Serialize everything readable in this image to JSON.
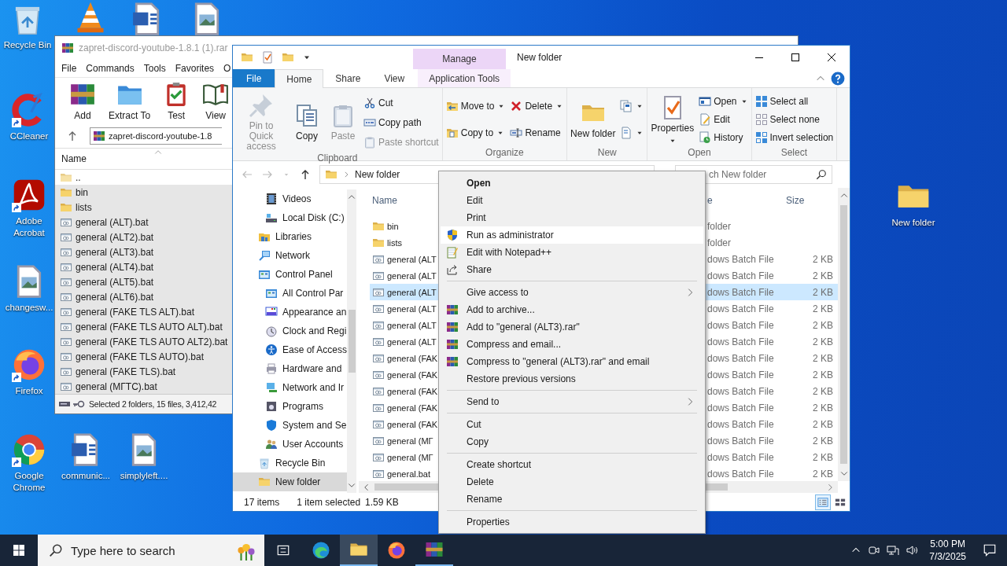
{
  "desktop_icons": [
    {
      "kind": "recycle",
      "label": "Recycle Bin",
      "shortcut": false
    },
    {
      "kind": "cone",
      "shortcut": false
    },
    {
      "kind": "word",
      "shortcut": false
    },
    {
      "kind": "image",
      "shortcut": false
    },
    {
      "kind": "ccleaner",
      "label": "CCleaner",
      "shortcut": true
    },
    {
      "kind": "acrobat",
      "label": "Adobe Acrobat",
      "shortcut": true
    },
    {
      "kind": "image",
      "label": "changesw...",
      "shortcut": false
    },
    {
      "kind": "firefox",
      "label": "Firefox",
      "shortcut": true
    },
    {
      "kind": "chrome",
      "label": "Google Chrome",
      "shortcut": true
    },
    {
      "kind": "word",
      "label": "communic...",
      "shortcut": false
    },
    {
      "kind": "image",
      "label": "simplyleft....",
      "shortcut": false
    },
    {
      "kind": "folder",
      "label": "New folder",
      "shortcut": false
    }
  ],
  "archive_window": {
    "title": "zapret-discord-youtube-1.8.1 (1).rar",
    "menu": [
      "File",
      "Commands",
      "Tools",
      "Favorites",
      "O"
    ],
    "toolbar": [
      {
        "kind": "add",
        "label": "Add"
      },
      {
        "kind": "extract",
        "label": "Extract To"
      },
      {
        "kind": "test",
        "label": "Test"
      },
      {
        "kind": "view",
        "label": "View"
      }
    ],
    "path": "zapret-discord-youtube-1.8",
    "column": "Name",
    "rows": [
      {
        "kind": "updir",
        "name": "..",
        "selected": false
      },
      {
        "kind": "folder",
        "name": "bin",
        "selected": true
      },
      {
        "kind": "folder",
        "name": "lists",
        "selected": true
      },
      {
        "kind": "bat",
        "name": "general (ALT).bat",
        "selected": true
      },
      {
        "kind": "bat",
        "name": "general (ALT2).bat",
        "selected": true
      },
      {
        "kind": "bat",
        "name": "general (ALT3).bat",
        "selected": true
      },
      {
        "kind": "bat",
        "name": "general (ALT4).bat",
        "selected": true
      },
      {
        "kind": "bat",
        "name": "general (ALT5).bat",
        "selected": true
      },
      {
        "kind": "bat",
        "name": "general (ALT6).bat",
        "selected": true
      },
      {
        "kind": "bat",
        "name": "general (FAKE TLS ALT).bat",
        "selected": true
      },
      {
        "kind": "bat",
        "name": "general (FAKE TLS AUTO ALT).bat",
        "selected": true
      },
      {
        "kind": "bat",
        "name": "general (FAKE TLS AUTO ALT2).bat",
        "selected": true
      },
      {
        "kind": "bat",
        "name": "general (FAKE TLS AUTO).bat",
        "selected": true
      },
      {
        "kind": "bat",
        "name": "general (FAKE TLS).bat",
        "selected": true
      },
      {
        "kind": "bat",
        "name": "general (МГТС).bat",
        "selected": true
      }
    ],
    "status": "Selected 2 folders, 15 files, 3,412,42"
  },
  "explorer": {
    "context_tab": "Manage",
    "title": "New folder",
    "tabs": [
      {
        "kind": "file",
        "label": "File",
        "selected": false
      },
      {
        "kind": "normal",
        "label": "Home",
        "selected": true
      },
      {
        "kind": "normal",
        "label": "Share",
        "selected": false
      },
      {
        "kind": "normal",
        "label": "View",
        "selected": false
      },
      {
        "kind": "context",
        "label": "Application Tools",
        "selected": false
      }
    ],
    "ribbon_groups": [
      {
        "label": "Clipboard",
        "columns": [
          [
            {
              "kind": "large",
              "label": "Pin to Quick access",
              "disabled": true,
              "dropdown": false
            }
          ],
          [
            {
              "kind": "large",
              "label": "Copy",
              "disabled": false,
              "dropdown": false
            }
          ],
          [
            {
              "kind": "large",
              "label": "Paste",
              "disabled": true,
              "dropdown": false
            }
          ],
          [
            {
              "kind": "small",
              "label": "Cut",
              "disabled": false,
              "dropdown": false
            },
            {
              "kind": "small",
              "label": "Copy path",
              "disabled": false,
              "dropdown": false
            },
            {
              "kind": "small",
              "label": "Paste shortcut",
              "disabled": true,
              "dropdown": false
            }
          ]
        ]
      },
      {
        "label": "Organize",
        "columns": [
          [
            {
              "kind": "small",
              "label": "Move to",
              "disabled": false,
              "dropdown": true
            },
            {
              "kind": "small",
              "label": "Copy to",
              "disabled": false,
              "dropdown": true
            }
          ],
          [
            {
              "kind": "small",
              "label": "Delete",
              "disabled": false,
              "dropdown": true
            },
            {
              "kind": "small",
              "label": "Rename",
              "disabled": false,
              "dropdown": false
            }
          ]
        ]
      },
      {
        "label": "New",
        "columns": [
          [
            {
              "kind": "large",
              "label": "New folder",
              "disabled": false,
              "dropdown": false
            }
          ],
          [
            {
              "kind": "small",
              "disabled": false,
              "dropdown": true
            },
            {
              "kind": "small",
              "disabled": false,
              "dropdown": true
            }
          ]
        ]
      },
      {
        "label": "Open",
        "columns": [
          [
            {
              "kind": "large",
              "label": "Properties",
              "disabled": false,
              "dropdown": true
            }
          ],
          [
            {
              "kind": "small",
              "label": "Open",
              "disabled": false,
              "dropdown": true
            },
            {
              "kind": "small",
              "label": "Edit",
              "disabled": false,
              "dropdown": false
            },
            {
              "kind": "small",
              "label": "History",
              "disabled": false,
              "dropdown": false
            }
          ]
        ]
      },
      {
        "label": "Select",
        "columns": [
          [
            {
              "kind": "small",
              "label": "Select all",
              "disabled": false,
              "dropdown": false
            },
            {
              "kind": "small",
              "label": "Select none",
              "disabled": false,
              "dropdown": false
            },
            {
              "kind": "small",
              "label": "Invert selection",
              "disabled": false,
              "dropdown": false
            }
          ]
        ]
      }
    ],
    "address": "New folder",
    "search": {
      "placeholder": "ch New folder"
    },
    "nav_pane": {
      "scrolled_group": [
        {
          "label": "Videos",
          "selected": false
        },
        {
          "label": "Local Disk (C:)",
          "selected": false
        }
      ],
      "items": [
        {
          "label": "Libraries",
          "selected": false
        },
        {
          "label": "Network",
          "selected": false
        },
        {
          "label": "Control Panel",
          "selected": false,
          "children": [
            {
              "label": "All Control Par",
              "selected": false
            },
            {
              "label": "Appearance an",
              "selected": false
            },
            {
              "label": "Clock and Regi",
              "selected": false
            },
            {
              "label": "Ease of Access",
              "selected": false
            },
            {
              "label": "Hardware and",
              "selected": false
            },
            {
              "label": "Network and Ir",
              "selected": false
            },
            {
              "label": "Programs",
              "selected": false
            },
            {
              "label": "System and Se",
              "selected": false
            },
            {
              "label": "User Accounts",
              "selected": false
            }
          ]
        },
        {
          "label": "Recycle Bin",
          "selected": false
        },
        {
          "label": "New folder",
          "selected": true
        }
      ]
    },
    "columns": [
      "Name",
      "e",
      "Size"
    ],
    "rows": [
      {
        "kind": "folder",
        "name": "bin",
        "type": "folder",
        "selected": false
      },
      {
        "kind": "folder",
        "name": "lists",
        "type": "folder",
        "selected": false
      },
      {
        "kind": "file",
        "name": "general (ALT",
        "type": "dows Batch File",
        "size": "2 KB",
        "selected": false
      },
      {
        "kind": "file",
        "name": "general (ALT",
        "type": "dows Batch File",
        "size": "2 KB",
        "selected": false
      },
      {
        "kind": "file",
        "name": "general (ALT",
        "type": "dows Batch File",
        "size": "2 KB",
        "selected": true
      },
      {
        "kind": "file",
        "name": "general (ALT",
        "type": "dows Batch File",
        "size": "2 KB",
        "selected": false
      },
      {
        "kind": "file",
        "name": "general (ALT",
        "type": "dows Batch File",
        "size": "2 KB",
        "selected": false
      },
      {
        "kind": "file",
        "name": "general (ALT",
        "type": "dows Batch File",
        "size": "2 KB",
        "selected": false
      },
      {
        "kind": "file",
        "name": "general (FAK",
        "type": "dows Batch File",
        "size": "2 KB",
        "selected": false
      },
      {
        "kind": "file",
        "name": "general (FAK",
        "type": "dows Batch File",
        "size": "2 KB",
        "selected": false
      },
      {
        "kind": "file",
        "name": "general (FAK",
        "type": "dows Batch File",
        "size": "2 KB",
        "selected": false
      },
      {
        "kind": "file",
        "name": "general (FAK",
        "type": "dows Batch File",
        "size": "2 KB",
        "selected": false
      },
      {
        "kind": "file",
        "name": "general (FAK",
        "type": "dows Batch File",
        "size": "2 KB",
        "selected": false
      },
      {
        "kind": "file",
        "name": "general (МГ",
        "type": "dows Batch File",
        "size": "2 KB",
        "selected": false
      },
      {
        "kind": "file",
        "name": "general (МГ",
        "type": "dows Batch File",
        "size": "2 KB",
        "selected": false
      },
      {
        "kind": "file",
        "name": "general.bat",
        "type": "dows Batch File",
        "size": "2 KB",
        "selected": false
      }
    ],
    "status": {
      "count": "17 items",
      "selection": "1 item selected",
      "size": "1.59 KB"
    },
    "views": [
      {
        "kind": "details",
        "selected": true
      },
      {
        "kind": "tiles",
        "selected": false
      }
    ]
  },
  "context_menu": {
    "items": [
      {
        "kind": "item",
        "label": "Open",
        "default": true,
        "highlighted": false,
        "submenu": false
      },
      {
        "kind": "item",
        "label": "Edit",
        "default": false,
        "highlighted": false,
        "submenu": false
      },
      {
        "kind": "item",
        "label": "Print",
        "default": false,
        "highlighted": false,
        "submenu": false
      },
      {
        "kind": "item",
        "label": "Run as administrator",
        "default": false,
        "highlighted": true,
        "submenu": false
      },
      {
        "kind": "item",
        "label": "Edit with Notepad++",
        "default": false,
        "highlighted": false,
        "submenu": false
      },
      {
        "kind": "item",
        "label": "Share",
        "default": false,
        "highlighted": false,
        "submenu": false
      },
      {
        "kind": "separator"
      },
      {
        "kind": "item",
        "label": "Give access to",
        "default": false,
        "highlighted": false,
        "submenu": true
      },
      {
        "kind": "item",
        "label": "Add to archive...",
        "default": false,
        "highlighted": false,
        "submenu": false
      },
      {
        "kind": "item",
        "label": "Add to \"general (ALT3).rar\"",
        "default": false,
        "highlighted": false,
        "submenu": false
      },
      {
        "kind": "item",
        "label": "Compress and email...",
        "default": false,
        "highlighted": false,
        "submenu": false
      },
      {
        "kind": "item",
        "label": "Compress to \"general (ALT3).rar\" and email",
        "default": false,
        "highlighted": false,
        "submenu": false
      },
      {
        "kind": "item",
        "label": "Restore previous versions",
        "default": false,
        "highlighted": false,
        "submenu": false
      },
      {
        "kind": "separator"
      },
      {
        "kind": "item",
        "label": "Send to",
        "default": false,
        "highlighted": false,
        "submenu": true
      },
      {
        "kind": "separator"
      },
      {
        "kind": "item",
        "label": "Cut",
        "default": false,
        "highlighted": false,
        "submenu": false
      },
      {
        "kind": "item",
        "label": "Copy",
        "default": false,
        "highlighted": false,
        "submenu": false
      },
      {
        "kind": "separator"
      },
      {
        "kind": "item",
        "label": "Create shortcut",
        "default": false,
        "highlighted": false,
        "submenu": false
      },
      {
        "kind": "item",
        "label": "Delete",
        "default": false,
        "highlighted": false,
        "submenu": false
      },
      {
        "kind": "item",
        "label": "Rename",
        "default": false,
        "highlighted": false,
        "submenu": false
      },
      {
        "kind": "separator"
      },
      {
        "kind": "item",
        "label": "Properties",
        "default": false,
        "highlighted": false,
        "submenu": false
      }
    ]
  },
  "taskbar": {
    "search_placeholder": "Type here to search",
    "apps": [
      {
        "kind": "taskview",
        "active": false,
        "running": false
      },
      {
        "kind": "edge",
        "active": false,
        "running": false
      },
      {
        "kind": "folder",
        "active": true,
        "running": true
      },
      {
        "kind": "firefox",
        "active": false,
        "running": false
      },
      {
        "kind": "winrar",
        "active": false,
        "running": true
      }
    ],
    "time": "5:00 PM",
    "date": "7/3/2025"
  }
}
